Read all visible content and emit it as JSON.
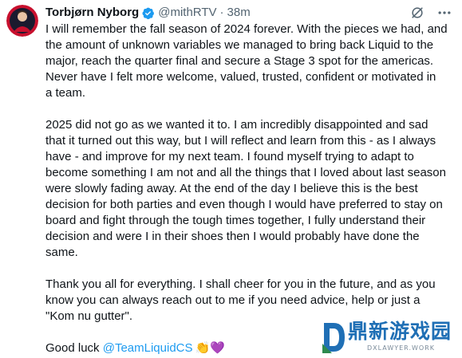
{
  "tweet": {
    "author_name": "Torbjørn Nyborg",
    "handle": "@mithRTV",
    "separator": "·",
    "time": "38m",
    "verified_color": "#1d9bf0",
    "mention_color": "#1d9bf0",
    "paragraphs": [
      [
        "I will remember the fall season of 2024 forever. With the pieces we had, and",
        "the amount of unknown variables we managed to bring back Liquid to the",
        "major, reach the quarter final and secure a Stage 3 spot for the americas.",
        "Never have I felt more welcome, valued, trusted, confident or motivated in",
        "a team."
      ],
      [
        "2025 did not go as we wanted it to. I am incredibly disappointed and sad",
        "that it turned out this way, but I will reflect and learn from this - as I always",
        "have - and improve for my next team. I found myself trying to adapt to",
        "become something I am not and all the things that I loved about last season",
        "were slowly fading away. At the end of the day I believe this is the best",
        "decision for both parties and even though I would have preferred to stay on",
        "board and fight through the tough times together, I fully understand their",
        "decision and were I in their shoes then I would probably have done the",
        "same."
      ],
      [
        "Thank you all for everything. I shall cheer for you in the future, and as you",
        "know you can always reach out to me if you need advice, help or just a",
        "\"Kom nu gutter\"."
      ]
    ],
    "closing_text": "Good luck ",
    "closing_mention": "@TeamLiquidCS",
    "closing_emojis": "👏💜"
  },
  "icons": {
    "verified": "verified-badge-icon",
    "grok": "grok-icon",
    "more": "more-options-icon",
    "avatar": "avatar"
  },
  "watermark": {
    "title": "鼎新游戏园",
    "subtitle": "DXLAWYER.WORK",
    "color": "#1f6fb5"
  }
}
